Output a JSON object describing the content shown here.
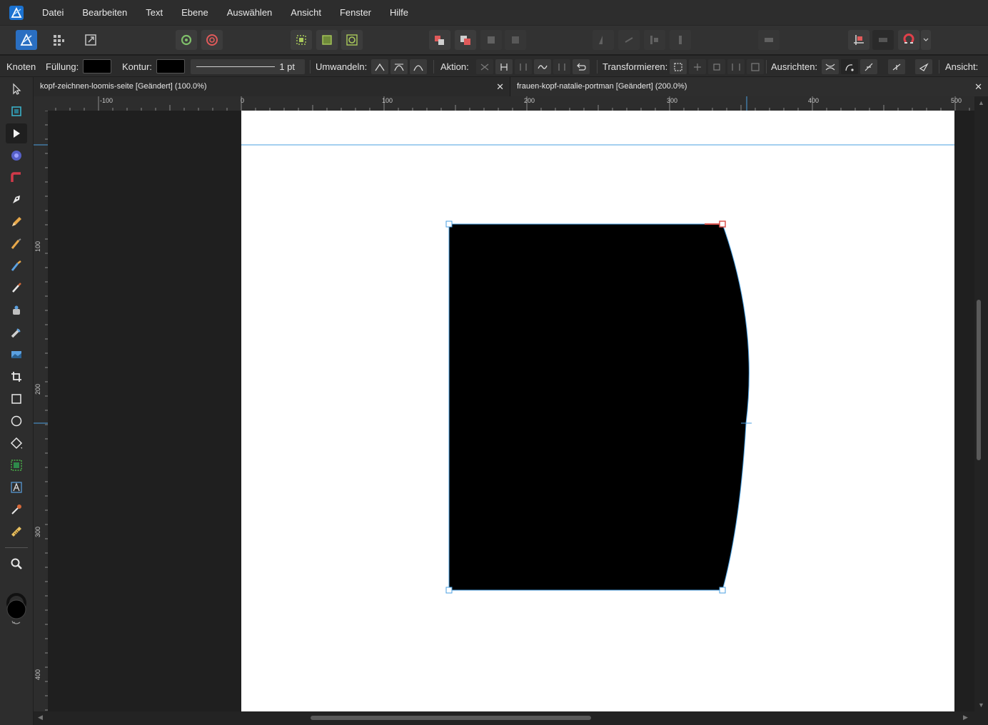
{
  "app": {
    "name": "Affinity Designer"
  },
  "menu": [
    "Datei",
    "Bearbeiten",
    "Text",
    "Ebene",
    "Auswählen",
    "Ansicht",
    "Fenster",
    "Hilfe"
  ],
  "context": {
    "tool_name": "Knoten",
    "fill_label": "Füllung:",
    "stroke_label": "Kontur:",
    "stroke_width": "1 pt",
    "convert_label": "Umwandeln:",
    "action_label": "Aktion:",
    "transform_label": "Transformieren:",
    "align_label": "Ausrichten:",
    "view_label": "Ansicht:",
    "fill_color": "#000000",
    "stroke_color": "#000000"
  },
  "tabs": [
    {
      "title": "kopf-zeichnen-loomis-seite [Geändert] (100.0%)",
      "close": "✕"
    },
    {
      "title": "frauen-kopf-natalie-portman [Geändert] (200.0%)",
      "close": "✕"
    }
  ],
  "ruler": {
    "unit": "px",
    "top_labels": [
      "-100",
      "0",
      "100",
      "200",
      "300",
      "400",
      "500"
    ],
    "left_labels": [
      "100",
      "200",
      "300",
      "400"
    ]
  },
  "colors": {
    "accent": "#4a9fe0",
    "shape_fill": "#000000",
    "page": "#ffffff",
    "selected_node": "#d9534f"
  }
}
